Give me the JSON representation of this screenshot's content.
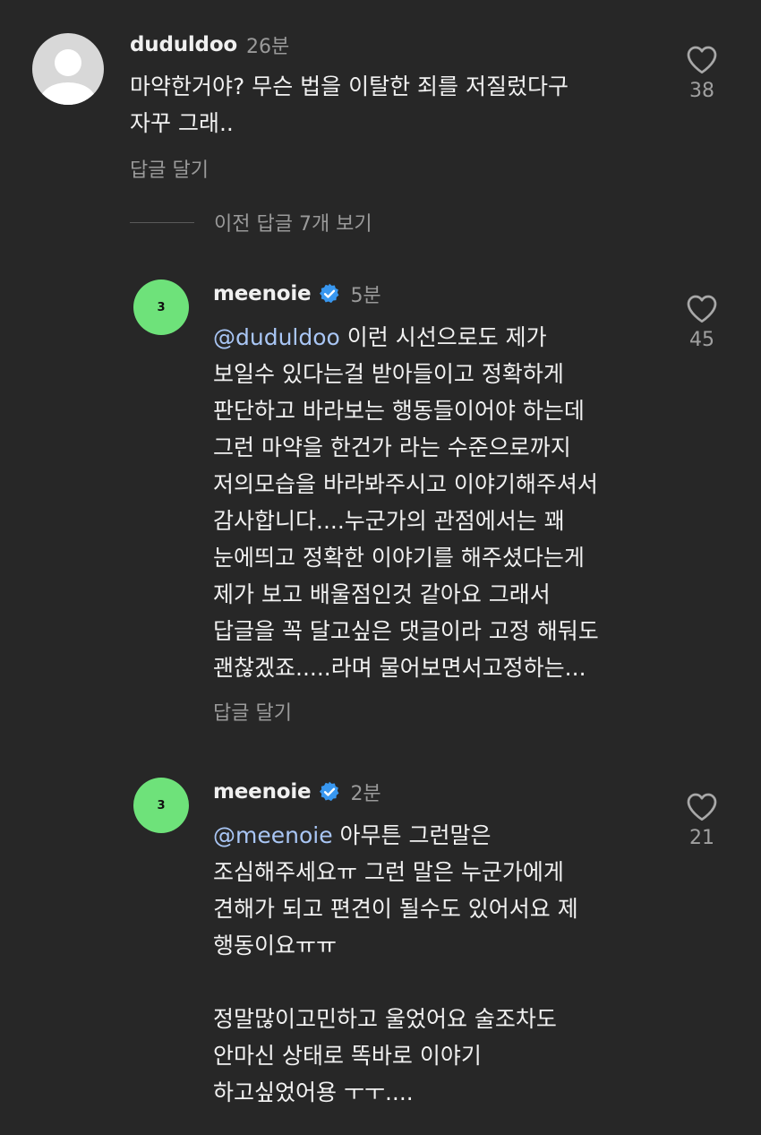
{
  "comments": [
    {
      "username": "duduldoo",
      "time": "26분",
      "lines": [
        "마약한거야? 무슨 법을 이탈한 죄를 저질렀다구",
        "자꾸 그래.."
      ],
      "reply_label": "답글 달기",
      "likes": "38"
    }
  ],
  "view_replies": {
    "label": "이전 답글 7개 보기"
  },
  "replies": [
    {
      "username": "meenoie",
      "avatar_text": "3",
      "time": "5분",
      "mention": "@duduldoo",
      "first_line_rest": " 이런 시선으로도 제가",
      "lines": [
        "보일수 있다는걸 받아들이고 정확하게",
        "판단하고 바라보는 행동들이어야 하는데",
        "그런 마약을 한건가 라는 수준으로까지",
        "저의모습을 바라봐주시고 이야기해주셔서",
        "감사합니다....누군가의 관점에서는 꽤",
        "눈에띄고 정확한 이야기를 해주셨다는게",
        "제가 보고 배울점인것 같아요 그래서",
        "답글을 꼭 달고싶은 댓글이라 고정 해둬도",
        "괜찮겠죠.....라며 물어보면서고정하는..."
      ],
      "reply_label": "답글 달기",
      "likes": "45"
    },
    {
      "username": "meenoie",
      "avatar_text": "3",
      "time": "2분",
      "mention": "@meenoie",
      "first_line_rest": " 아무튼 그런말은",
      "lines": [
        "조심해주세요ㅠ 그런 말은 누군가에게",
        "견해가 되고 편견이 될수도 있어서요 제",
        "행동이요ㅠㅠ",
        "",
        "정말많이고민하고 울었어요 술조차도",
        "안마신 상태로 똑바로 이야기",
        "하고싶었어용 ㅜㅜ...."
      ],
      "likes": "21"
    }
  ],
  "icons": {
    "like": "heart-outline-icon",
    "verified": "verified-badge-icon",
    "avatar": "default-avatar-icon"
  },
  "colors": {
    "background": "#272727",
    "text": "#f1f1f1",
    "muted": "#9a9a9a",
    "mention": "#a9c6f5",
    "verified": "#3897f0",
    "avatar_green": "#6ee27a"
  }
}
